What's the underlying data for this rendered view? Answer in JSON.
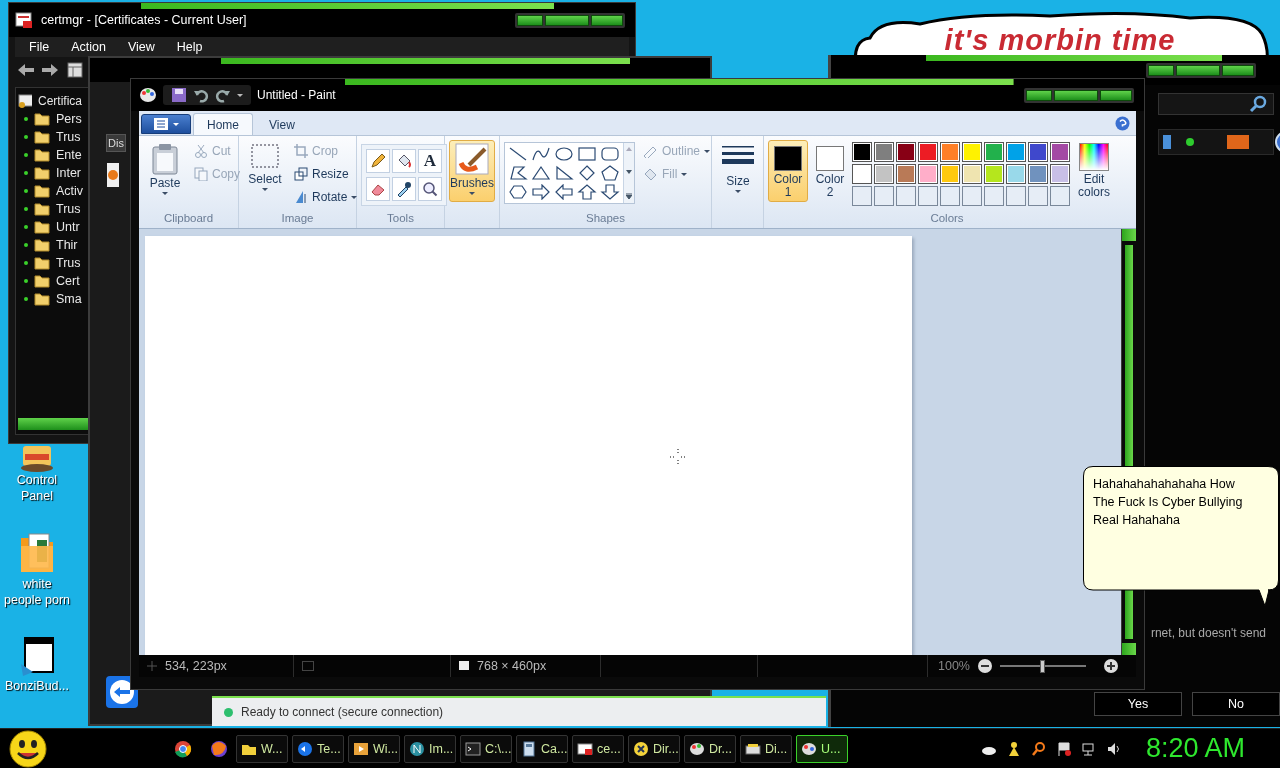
{
  "desktop": {
    "banner": "it's morbin time",
    "icons": [
      {
        "label": "Control Panel"
      },
      {
        "label": "white people porn"
      },
      {
        "label": "BonziBud..."
      }
    ]
  },
  "certmgr": {
    "title": "certmgr - [Certificates - Current User]",
    "menu": [
      "File",
      "Action",
      "View",
      "Help"
    ],
    "tree": {
      "label": "Certifica",
      "children": [
        {
          "label": "Pers"
        },
        {
          "label": "Trus"
        },
        {
          "label": "Ente"
        },
        {
          "label": "Inter"
        },
        {
          "label": "Activ"
        },
        {
          "label": "Trus"
        },
        {
          "label": "Untr"
        },
        {
          "label": "Thir"
        },
        {
          "label": "Trus"
        },
        {
          "label": "Cert"
        },
        {
          "label": "Sma"
        }
      ]
    }
  },
  "middle_window": {
    "tab": "Dis",
    "status": "Ready to connect (secure connection)"
  },
  "right_window": {
    "text": "rnet, but doesn't send",
    "buttons": [
      "Yes",
      "No"
    ]
  },
  "paint": {
    "title": "Untitled - Paint",
    "tabs": [
      {
        "label": "Home",
        "selected": true
      },
      {
        "label": "View",
        "selected": false
      }
    ],
    "clipboard": {
      "label": "Clipboard",
      "paste": "Paste",
      "cut": {
        "label": "Cut",
        "disabled": true
      },
      "copy": {
        "label": "Copy",
        "disabled": true
      }
    },
    "image": {
      "label": "Image",
      "select": "Select",
      "crop": {
        "label": "Crop",
        "disabled": true
      },
      "resize": {
        "label": "Resize",
        "disabled": false
      },
      "rotate": {
        "label": "Rotate",
        "disabled": false
      }
    },
    "tools": {
      "label": "Tools",
      "text_tool": "A"
    },
    "brushes": {
      "label": "Brushes",
      "selected": true
    },
    "shapes": {
      "label": "Shapes",
      "outline": {
        "label": "Outline",
        "disabled": true
      },
      "fill": {
        "label": "Fill",
        "disabled": true
      }
    },
    "size": "Size",
    "colors": {
      "label": "Colors",
      "color1": {
        "label": "Color 1",
        "color": "#000000",
        "selected": true
      },
      "color2": {
        "label": "Color 2",
        "color": "#ffffff",
        "selected": false
      },
      "palette": [
        {
          "color": "#000000"
        },
        {
          "color": "#7f7f7f"
        },
        {
          "color": "#880015"
        },
        {
          "color": "#ed1c24"
        },
        {
          "color": "#ff7f27"
        },
        {
          "color": "#fff200"
        },
        {
          "color": "#22b14c"
        },
        {
          "color": "#00a2e8"
        },
        {
          "color": "#3f48cc"
        },
        {
          "color": "#a349a4"
        },
        {
          "color": "#ffffff"
        },
        {
          "color": "#c3c3c3"
        },
        {
          "color": "#b97a57"
        },
        {
          "color": "#ffaec9"
        },
        {
          "color": "#ffc90e"
        },
        {
          "color": "#efe4b0"
        },
        {
          "color": "#b5e61d"
        },
        {
          "color": "#99d9ea"
        },
        {
          "color": "#7092be"
        },
        {
          "color": "#c8bfe7"
        }
      ],
      "edit": "Edit colors"
    },
    "status": {
      "position": "534, 223px",
      "dimensions": "768 × 460px",
      "zoom": "100%",
      "zoom_slider": {
        "level": 0.5
      }
    }
  },
  "bubble": {
    "text": "Hahahahahahahaha How The Fuck Is Cyber Bullying Real Hahahaha"
  },
  "taskbar": {
    "tasks": [
      {
        "label": "W...",
        "selected": false
      },
      {
        "label": "Te...",
        "selected": false
      },
      {
        "label": "Wi...",
        "selected": false
      },
      {
        "label": "Im...",
        "selected": false
      },
      {
        "label": "C:\\...",
        "selected": false
      },
      {
        "label": "Ca...",
        "selected": false
      },
      {
        "label": "ce...",
        "selected": false
      },
      {
        "label": "Dir...",
        "selected": false
      },
      {
        "label": "Dr...",
        "selected": false
      },
      {
        "label": "Di...",
        "selected": false
      },
      {
        "label": "U...",
        "selected": true
      }
    ],
    "clock": "8:20 AM"
  }
}
